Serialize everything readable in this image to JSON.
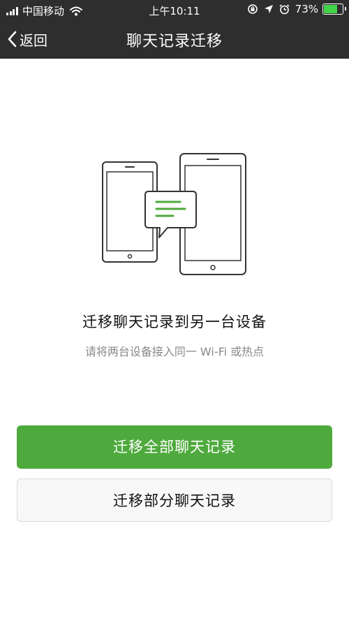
{
  "status_bar": {
    "carrier": "中国移动",
    "time": "上午10:11",
    "battery_percent": "73%",
    "battery_level": 0.73,
    "icons": [
      "signal-icon",
      "wifi-icon",
      "orientation-lock-icon",
      "location-icon",
      "alarm-icon",
      "battery-icon"
    ]
  },
  "nav": {
    "back_label": "返回",
    "title": "聊天记录迁移"
  },
  "content": {
    "heading": "迁移聊天记录到另一台设备",
    "hint": "请将两台设备接入同一 Wi-Fi 或热点"
  },
  "actions": {
    "migrate_all": "迁移全部聊天记录",
    "migrate_partial": "迁移部分聊天记录"
  },
  "colors": {
    "bar_background": "#2e2e2e",
    "primary_green": "#4eaa3d",
    "battery_green": "#43d34b"
  }
}
